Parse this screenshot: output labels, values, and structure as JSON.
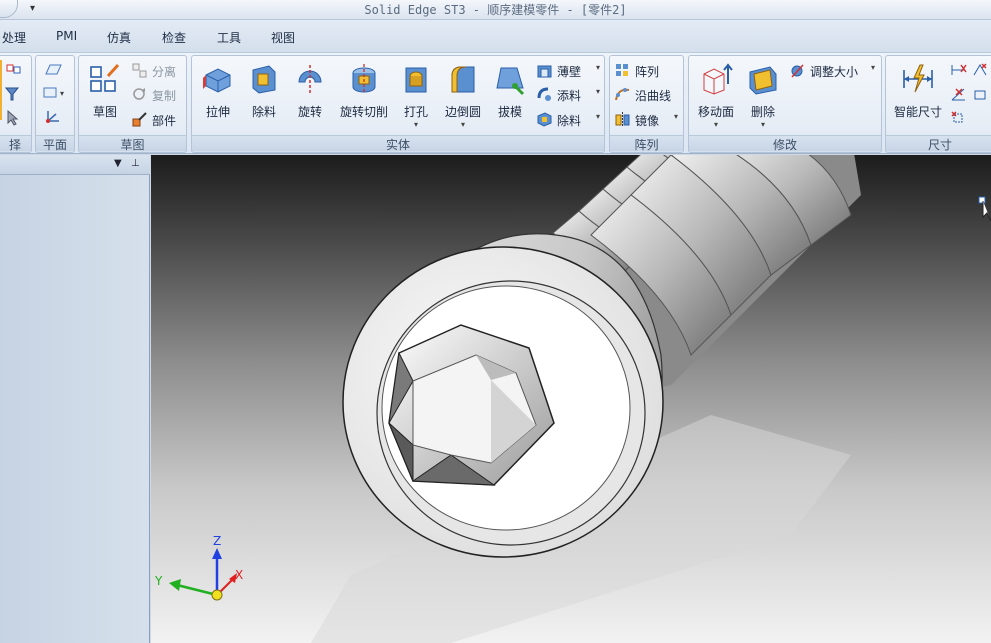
{
  "window": {
    "title": "Solid Edge ST3 - 顺序建模零件 - [零件2]"
  },
  "tabs": [
    "处理",
    "PMI",
    "仿真",
    "检查",
    "工具",
    "视图"
  ],
  "ribbon": {
    "partial_group": {
      "label": "择"
    },
    "plane_group": {
      "label": "平面"
    },
    "sketch_group": {
      "label": "草图",
      "sketch": "草图",
      "separate": "分离",
      "copy": "复制",
      "part": "部件"
    },
    "solid_group": {
      "label": "实体",
      "extrude": "拉伸",
      "cut": "除料",
      "revolve": "旋转",
      "revolve_cut": "旋转切削",
      "hole": "打孔",
      "round": "边倒圆",
      "draft": "拔模",
      "thin_wall": "薄壁",
      "add": "添料",
      "remove": "除料"
    },
    "pattern_group": {
      "label": "阵列",
      "pattern": "阵列",
      "along_curve": "沿曲线",
      "mirror": "镜像"
    },
    "modify_group": {
      "label": "修改",
      "move_face": "移动面",
      "delete": "删除",
      "resize": "调整大小"
    },
    "dimension_group": {
      "label": "尺寸",
      "smart_dimension": "智能尺寸"
    }
  },
  "axes": {
    "x": "X",
    "y": "Y",
    "z": "Z"
  },
  "colors": {
    "ribbon_bg": "#dce6f2",
    "panel_bg": "#c6d3e3",
    "axis_x": "#e02020",
    "axis_y": "#20b020",
    "axis_z": "#2040e0",
    "axis_origin": "#f0e020"
  }
}
